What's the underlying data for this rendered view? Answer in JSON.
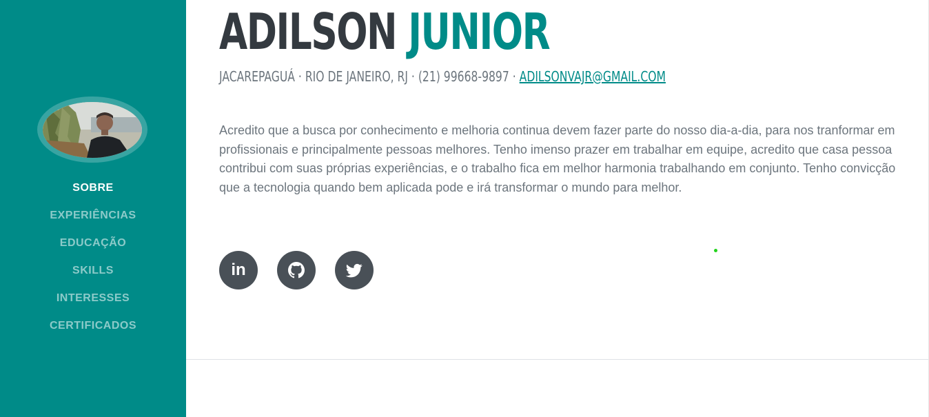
{
  "sidebar": {
    "nav": [
      {
        "label": "SOBRE",
        "active": true
      },
      {
        "label": "EXPERIÊNCIAS"
      },
      {
        "label": "EDUCAÇÃO"
      },
      {
        "label": "SKILLS"
      },
      {
        "label": "INTERESSES"
      },
      {
        "label": "CERTIFICADOS"
      }
    ]
  },
  "header": {
    "first_name": "ADILSON",
    "last_name": "JUNIOR",
    "contact": "JACAREPAGUÁ · RIO DE JANEIRO, RJ · (21) 99668-9897 · ",
    "email": "ADILSONVAJR@GMAIL.COM"
  },
  "about": {
    "text": "Acredito que a busca por conhecimento e melhoria continua devem fazer parte do nosso dia-a-dia, para nos tranformar em profissionais e principalmente pessoas melhores. Tenho imenso prazer em trabalhar em equipe, acredito que casa pessoa contribui com suas próprias experiências, e o trabalho fica em melhor harmonia trabalhando em conjunto. Tenho convicção que a tecnologia quando bem aplicada pode e irá transformar o mundo para melhor."
  },
  "social": [
    {
      "icon": "linkedin-icon",
      "glyph": "in"
    },
    {
      "icon": "github-icon"
    },
    {
      "icon": "twitter-icon"
    }
  ],
  "colors": {
    "primary": "#008b88",
    "dark": "#343a40",
    "muted": "#6c757d",
    "social_bg": "#495057"
  }
}
